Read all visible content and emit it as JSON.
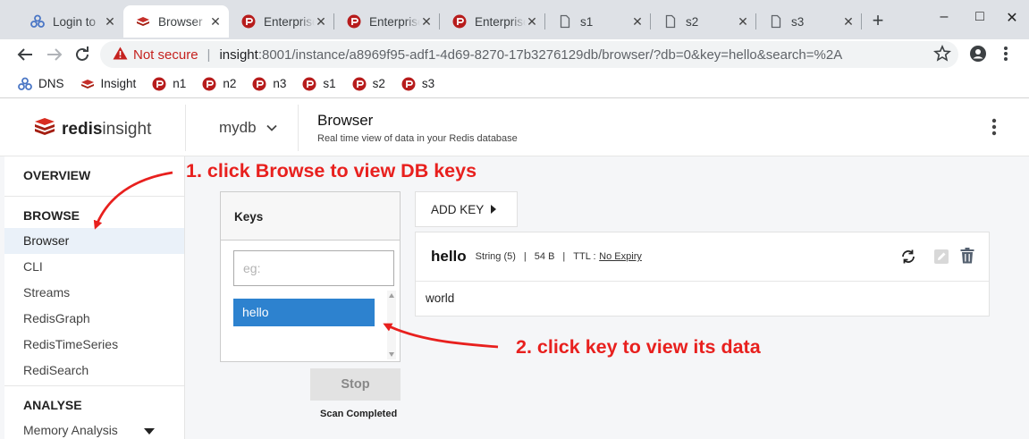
{
  "browser": {
    "tabs": [
      {
        "label": "Login to",
        "icon": "dns-icon"
      },
      {
        "label": "Browser",
        "icon": "redis-icon"
      },
      {
        "label": "Enterprise",
        "icon": "enterprise-icon"
      },
      {
        "label": "Enterprise",
        "icon": "enterprise-icon"
      },
      {
        "label": "Enterprise",
        "icon": "enterprise-icon"
      },
      {
        "label": "s1",
        "icon": "page-icon"
      },
      {
        "label": "s2",
        "icon": "page-icon"
      },
      {
        "label": "s3",
        "icon": "page-icon"
      }
    ],
    "close_glyph": "✕",
    "new_tab_glyph": "+",
    "window_controls": {
      "minimize": "–",
      "maximize": "□",
      "close": "✕"
    },
    "address": {
      "security": "Not secure",
      "host": "insight",
      "rest": ":8001/instance/a8969f95-adf1-4d69-8270-17b3276129db/browser/?db=0&key=hello&search=%2A"
    },
    "bookmarks": [
      {
        "label": "DNS",
        "icon": "dns-icon"
      },
      {
        "label": "Insight",
        "icon": "redis-icon"
      },
      {
        "label": "n1",
        "icon": "enterprise-icon"
      },
      {
        "label": "n2",
        "icon": "enterprise-icon"
      },
      {
        "label": "n3",
        "icon": "enterprise-icon"
      },
      {
        "label": "s1",
        "icon": "enterprise-icon"
      },
      {
        "label": "s2",
        "icon": "enterprise-icon"
      },
      {
        "label": "s3",
        "icon": "enterprise-icon"
      }
    ]
  },
  "app": {
    "logo": {
      "brand": "redis",
      "product": "insight"
    },
    "db_name": "mydb",
    "page_title": "Browser",
    "page_subtitle": "Real time view of data in your Redis database"
  },
  "sidebar": {
    "overview": "OVERVIEW",
    "browse_title": "BROWSE",
    "browse_items": [
      "Browser",
      "CLI",
      "Streams",
      "RedisGraph",
      "RedisTimeSeries",
      "RediSearch"
    ],
    "analyse_title": "ANALYSE",
    "analyse_items": [
      "Memory Analysis"
    ]
  },
  "keys_panel": {
    "title": "Keys",
    "search_placeholder": "eg:",
    "keys": [
      "hello"
    ],
    "stop_label": "Stop",
    "scan_status": "Scan Completed"
  },
  "add_key_label": "ADD KEY",
  "key_detail": {
    "name": "hello",
    "type": "String (5)",
    "size": "54 B",
    "ttl_label": "TTL :",
    "ttl_value": "No Expiry",
    "separator": "|",
    "value": "world"
  },
  "annotations": {
    "step1": "1. click Browse to view DB keys",
    "step2": "2. click key to view its data"
  },
  "colors": {
    "accent": "#2d82cf",
    "annotation": "#e8201e",
    "redis_red": "#c6302b",
    "not_secure": "#c5221f"
  }
}
